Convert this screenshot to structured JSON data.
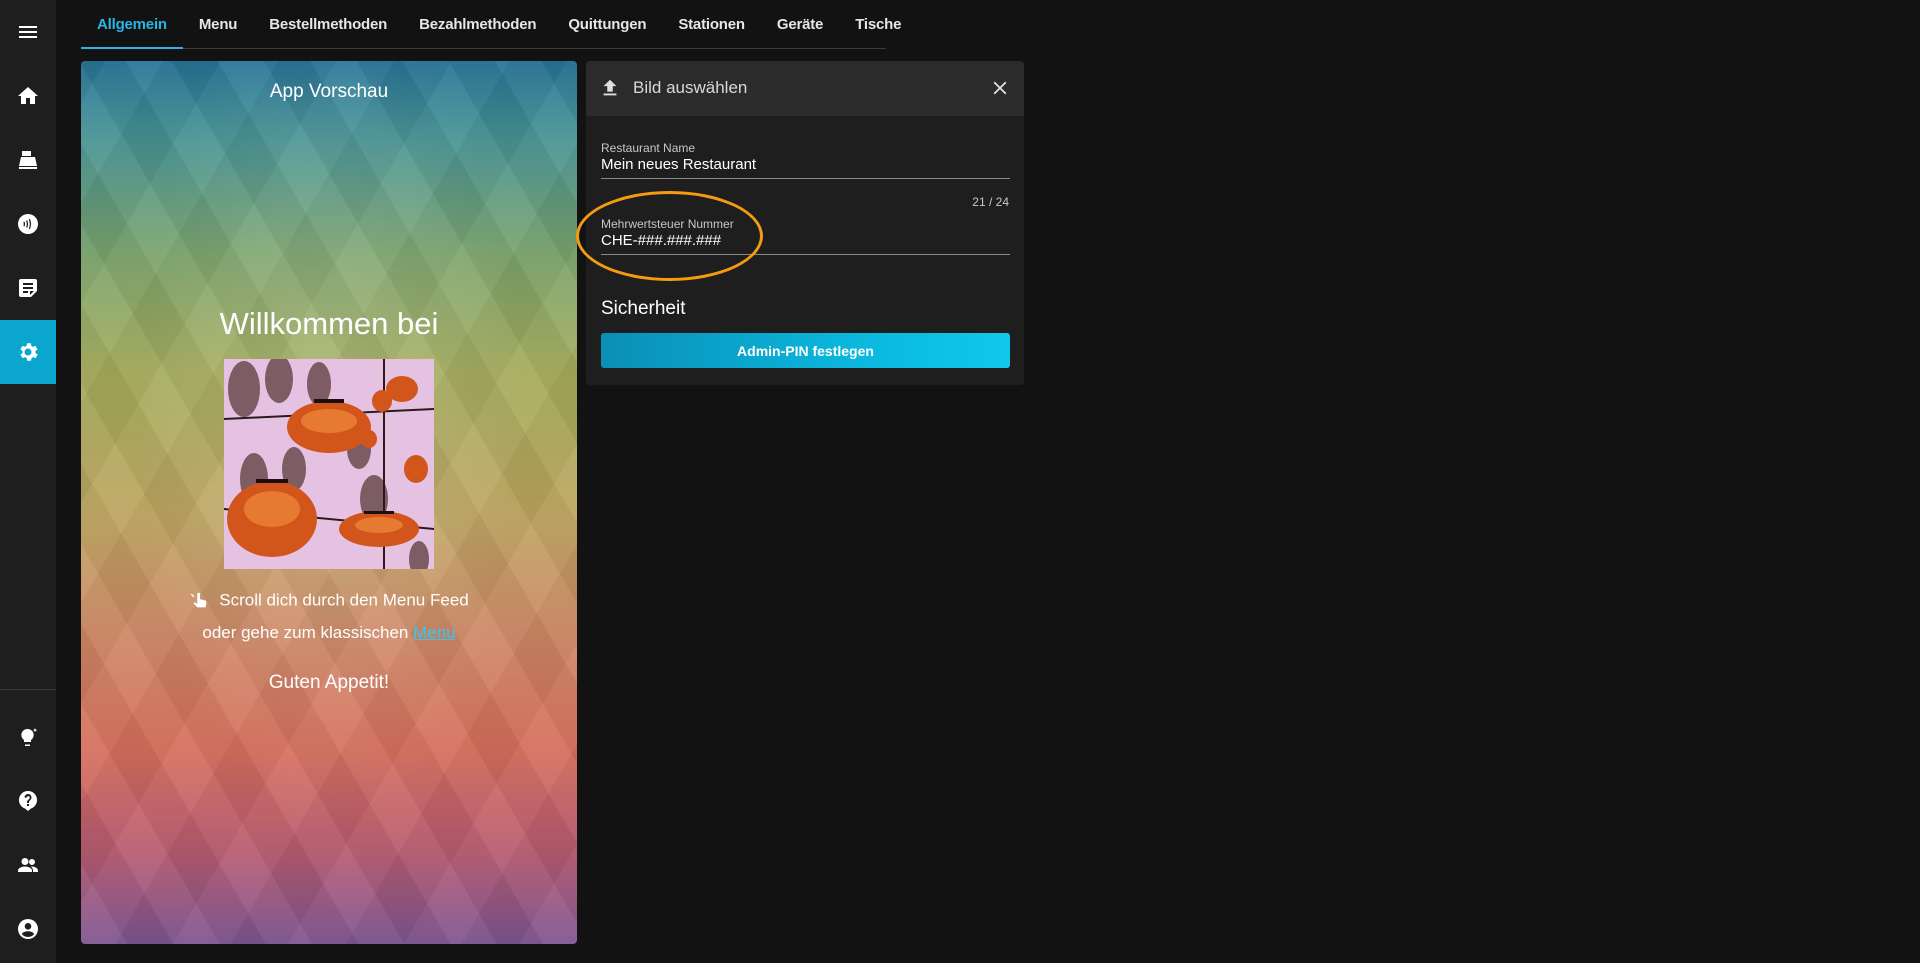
{
  "sidebar": {
    "items": [
      {
        "icon": "menu-icon"
      },
      {
        "icon": "home-icon"
      },
      {
        "icon": "cash-register-icon"
      },
      {
        "icon": "contactless-icon"
      },
      {
        "icon": "orders-icon"
      },
      {
        "icon": "settings-icon",
        "active": true
      },
      {
        "icon": "lightbulb-icon"
      },
      {
        "icon": "help-icon"
      },
      {
        "icon": "users-icon"
      },
      {
        "icon": "account-icon"
      }
    ]
  },
  "tabs": [
    {
      "label": "Allgemein",
      "active": true
    },
    {
      "label": "Menu"
    },
    {
      "label": "Bestellmethoden"
    },
    {
      "label": "Bezahlmethoden"
    },
    {
      "label": "Quittungen"
    },
    {
      "label": "Stationen"
    },
    {
      "label": "Geräte"
    },
    {
      "label": "Tische"
    }
  ],
  "preview": {
    "title": "App Vorschau",
    "welcome": "Willkommen bei",
    "scroll_text": "Scroll dich durch den Menu Feed",
    "line2_text": "oder gehe zum klassischen",
    "menu_link": "Menu",
    "appetit": "Guten Appetit!"
  },
  "card": {
    "header_label": "Bild auswählen",
    "restaurant_name": {
      "label": "Restaurant Name",
      "value": "Mein neues Restaurant",
      "counter": "21 / 24"
    },
    "vat": {
      "label": "Mehrwertsteuer Nummer",
      "value": "CHE-###.###.###"
    },
    "security_title": "Sicherheit",
    "admin_pin_button": "Admin-PIN festlegen"
  },
  "colors": {
    "accent": "#0aa6cf",
    "active_tab": "#29b6e6",
    "highlight": "#f59b12",
    "background": "#121212",
    "sidebar": "#1e1e1e"
  }
}
